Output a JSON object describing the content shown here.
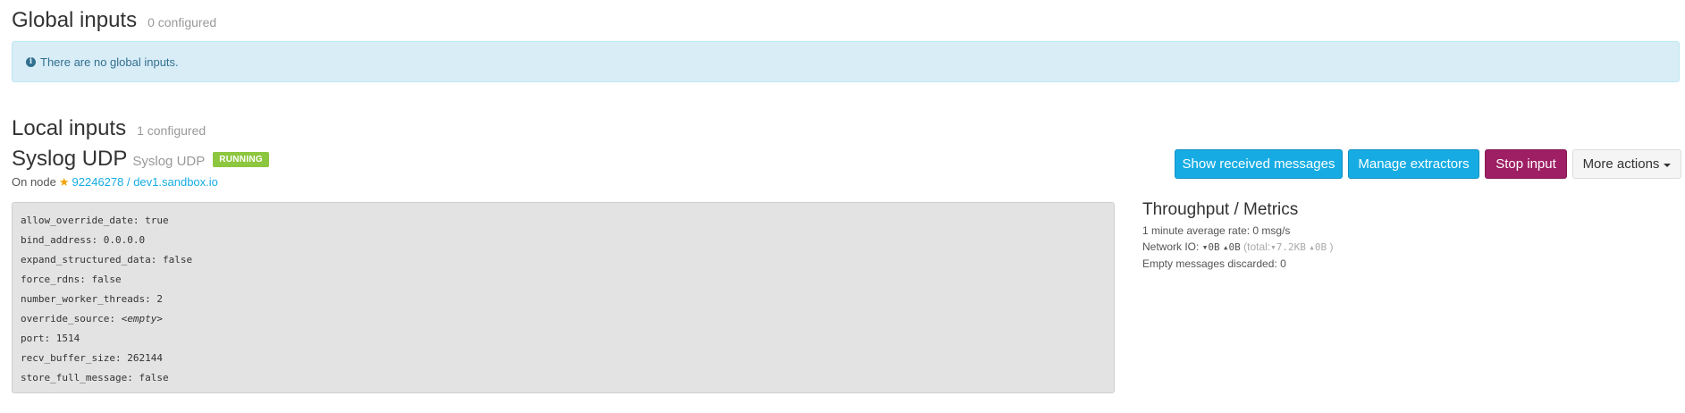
{
  "global_inputs": {
    "title": "Global inputs",
    "count_label": "0 configured",
    "alert_icon": "info-icon",
    "alert_text": "There are no global inputs."
  },
  "local_inputs": {
    "title": "Local inputs",
    "count_label": "1 configured"
  },
  "input": {
    "name": "Syslog UDP",
    "type": "Syslog UDP",
    "status": "RUNNING",
    "node_prefix": "On node",
    "node_icon": "star-icon",
    "node_link": "92246278 / dev1.sandbox.io",
    "config": [
      {
        "key": "allow_override_date:",
        "value": "true"
      },
      {
        "key": "bind_address:",
        "value": "0.0.0.0"
      },
      {
        "key": "expand_structured_data:",
        "value": "false"
      },
      {
        "key": "force_rdns:",
        "value": "false"
      },
      {
        "key": "number_worker_threads:",
        "value": "2"
      },
      {
        "key": "override_source:",
        "value": "<empty>"
      },
      {
        "key": "port:",
        "value": "1514"
      },
      {
        "key": "recv_buffer_size:",
        "value": "262144"
      },
      {
        "key": "store_full_message:",
        "value": "false"
      }
    ]
  },
  "actions": {
    "show_messages": "Show received messages",
    "manage_extractors": "Manage extractors",
    "stop_input": "Stop input",
    "more_actions": "More actions"
  },
  "metrics": {
    "title": "Throughput / Metrics",
    "avg_rate_label": "1 minute average rate:",
    "avg_rate_value": "0 msg/s",
    "network_label": "Network IO:",
    "net_in": "▾0B",
    "net_out": "▴0B",
    "total_prefix": "(total:",
    "total_in": "▾7.2KB",
    "total_out": "▴0B",
    "total_suffix": ")",
    "empty_label": "Empty messages discarded:",
    "empty_value": "0"
  },
  "colors": {
    "info": "#16ace3",
    "stop": "#9e1f63",
    "running": "#8dc63f",
    "alert_bg": "#d9edf7"
  }
}
